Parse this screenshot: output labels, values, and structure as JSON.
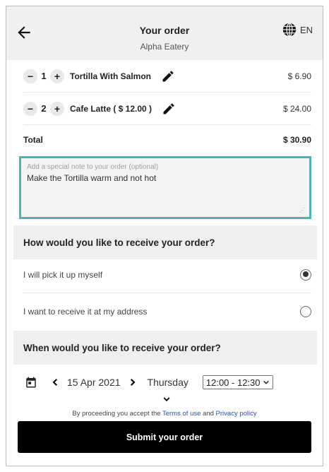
{
  "header": {
    "title": "Your order",
    "subtitle": "Alpha Eatery",
    "language": "EN",
    "back_icon": "arrow-left-icon",
    "language_icon": "globe-icon"
  },
  "items": [
    {
      "quantity": "1",
      "name": "Tortilla With Salmon",
      "price": "$ 6.90"
    },
    {
      "quantity": "2",
      "name": "Cafe Latte ( $ 12.00 )",
      "price": "$ 24.00"
    }
  ],
  "controls": {
    "decrease": "−",
    "increase": "+"
  },
  "total": {
    "label": "Total",
    "value": "$ 30.90"
  },
  "note": {
    "placeholder": "Add a special note to your order (optional)",
    "value": "Make the Tortilla warm and not hot"
  },
  "receive": {
    "heading": "How would you like to receive your order?",
    "options": [
      {
        "label": "I will pick it up myself",
        "selected": true
      },
      {
        "label": "I want to receive it at my address",
        "selected": false
      }
    ]
  },
  "when": {
    "heading": "When would you like to receive your order?",
    "date": "15 Apr 2021",
    "day": "Thursday",
    "time_slot": "12:00 - 12:30"
  },
  "terms": {
    "prefix": "By proceeding you accept the",
    "terms_link": "Terms of use",
    "and": "and",
    "privacy_link": "Privacy policy"
  },
  "submit_label": "Submit your order",
  "colors": {
    "accent": "#4fb2ae",
    "button": "#000000",
    "header_bg": "#f0f0f0",
    "link": "#2b4fb5"
  }
}
